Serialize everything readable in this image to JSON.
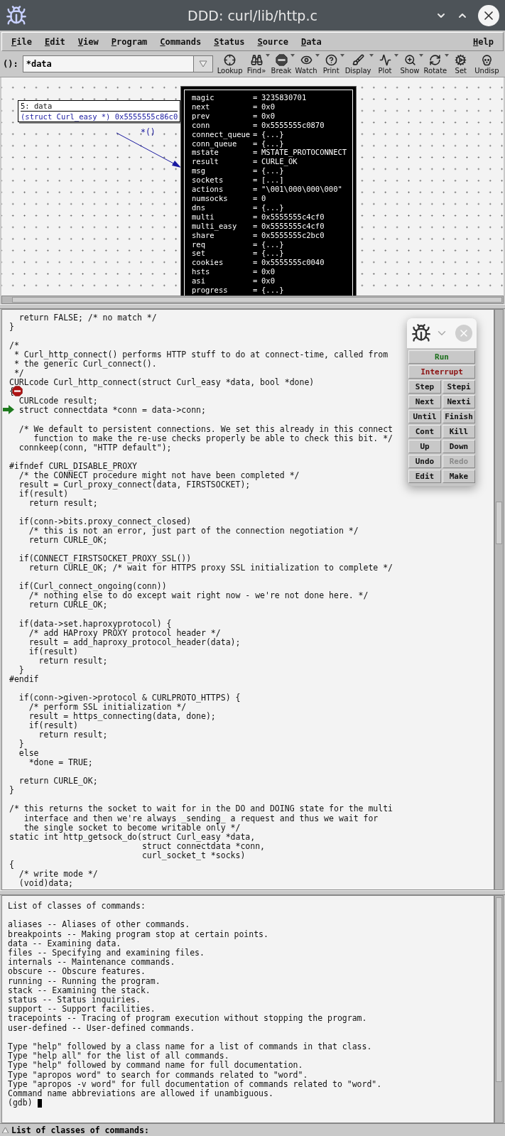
{
  "window": {
    "title": "DDD: curl/lib/http.c"
  },
  "menu": [
    "File",
    "Edit",
    "View",
    "Program",
    "Commands",
    "Status",
    "Source",
    "Data"
  ],
  "help_menu": "Help",
  "argument_field": {
    "label": "():",
    "value": "*data"
  },
  "toolbar": [
    {
      "label": "Lookup",
      "has_menu": false
    },
    {
      "label": "Find»",
      "has_menu": true
    },
    {
      "label": "Break",
      "has_menu": true
    },
    {
      "label": "Watch",
      "has_menu": true
    },
    {
      "label": "Print",
      "has_menu": true
    },
    {
      "label": "Display",
      "has_menu": true
    },
    {
      "label": "Plot",
      "has_menu": true
    },
    {
      "label": "Show",
      "has_menu": true
    },
    {
      "label": "Rotate",
      "has_menu": true
    },
    {
      "label": "Set",
      "has_menu": false
    },
    {
      "label": "Undisp",
      "has_menu": false
    }
  ],
  "data_display": {
    "node": {
      "title": "5: data",
      "value": "(struct Curl_easy *) 0x5555555c86c0"
    },
    "edge_label": "*()",
    "separator": "=",
    "fields": [
      {
        "name": "magic",
        "value": "3235830701"
      },
      {
        "name": "next",
        "value": "0x0"
      },
      {
        "name": "prev",
        "value": "0x0"
      },
      {
        "name": "conn",
        "value": "0x5555555c0870"
      },
      {
        "name": "connect_queue",
        "value": "{...}"
      },
      {
        "name": "conn_queue",
        "value": "{...}"
      },
      {
        "name": "mstate",
        "value": "MSTATE_PROTOCONNECT"
      },
      {
        "name": "result",
        "value": "CURLE_OK"
      },
      {
        "name": "msg",
        "value": "{...}"
      },
      {
        "name": "sockets",
        "value": "[...]"
      },
      {
        "name": "actions",
        "value": "\"\\001\\000\\000\\000\""
      },
      {
        "name": "numsocks",
        "value": "0"
      },
      {
        "name": "dns",
        "value": "{...}"
      },
      {
        "name": "multi",
        "value": "0x5555555c4cf0"
      },
      {
        "name": "multi_easy",
        "value": "0x5555555c4cf0"
      },
      {
        "name": "share",
        "value": "0x5555555c2bc0"
      },
      {
        "name": "req",
        "value": "{...}"
      },
      {
        "name": "set",
        "value": "{...}"
      },
      {
        "name": "cookies",
        "value": "0x5555555c0040"
      },
      {
        "name": "hsts",
        "value": "0x0"
      },
      {
        "name": "asi",
        "value": "0x0"
      },
      {
        "name": "progress",
        "value": "{...}"
      }
    ]
  },
  "source": {
    "lines": [
      {
        "text": "  return FALSE; /* no match */",
        "breakpoint": false,
        "current": false
      },
      {
        "text": "}",
        "breakpoint": false,
        "current": false
      },
      {
        "breakpoint": false,
        "current": false
      },
      {
        "text": "/*",
        "breakpoint": false,
        "current": false
      },
      {
        "text": " * Curl_http_connect() performs HTTP stuff to do at connect-time, called from",
        "breakpoint": false,
        "current": false
      },
      {
        "text": " * the generic Curl_connect().",
        "breakpoint": false,
        "current": false
      },
      {
        "text": " */",
        "breakpoint": false,
        "current": false
      },
      {
        "text": "CURLcode Curl_http_connect(struct Curl_easy *data, bool *done)",
        "breakpoint": false,
        "current": false
      },
      {
        "text": "{",
        "breakpoint": true,
        "current": false
      },
      {
        "text": "  CURLcode result;",
        "breakpoint": false,
        "current": false
      },
      {
        "text": "  struct connectdata *conn = data->conn;",
        "breakpoint": false,
        "current": true
      },
      {
        "breakpoint": false,
        "current": false
      },
      {
        "text": "  /* We default to persistent connections. We set this already in this connect",
        "breakpoint": false,
        "current": false
      },
      {
        "text": "     function to make the re-use checks properly be able to check this bit. */",
        "breakpoint": false,
        "current": false
      },
      {
        "text": "  connkeep(conn, \"HTTP default\");",
        "breakpoint": false,
        "current": false
      },
      {
        "breakpoint": false,
        "current": false
      },
      {
        "text": "#ifndef CURL_DISABLE_PROXY",
        "breakpoint": false,
        "current": false
      },
      {
        "text": "  /* the CONNECT procedure might not have been completed */",
        "breakpoint": false,
        "current": false
      },
      {
        "text": "  result = Curl_proxy_connect(data, FIRSTSOCKET);",
        "breakpoint": false,
        "current": false
      },
      {
        "text": "  if(result)",
        "breakpoint": false,
        "current": false
      },
      {
        "text": "    return result;",
        "breakpoint": false,
        "current": false
      },
      {
        "breakpoint": false,
        "current": false
      },
      {
        "text": "  if(conn->bits.proxy_connect_closed)",
        "breakpoint": false,
        "current": false
      },
      {
        "text": "    /* this is not an error, just part of the connection negotiation */",
        "breakpoint": false,
        "current": false
      },
      {
        "text": "    return CURLE_OK;",
        "breakpoint": false,
        "current": false
      },
      {
        "breakpoint": false,
        "current": false
      },
      {
        "text": "  if(CONNECT_FIRSTSOCKET_PROXY_SSL())",
        "breakpoint": false,
        "current": false
      },
      {
        "text": "    return CURLE_OK; /* wait for HTTPS proxy SSL initialization to complete */",
        "breakpoint": false,
        "current": false
      },
      {
        "breakpoint": false,
        "current": false
      },
      {
        "text": "  if(Curl_connect_ongoing(conn))",
        "breakpoint": false,
        "current": false
      },
      {
        "text": "    /* nothing else to do except wait right now - we're not done here. */",
        "breakpoint": false,
        "current": false
      },
      {
        "text": "    return CURLE_OK;",
        "breakpoint": false,
        "current": false
      },
      {
        "breakpoint": false,
        "current": false
      },
      {
        "text": "  if(data->set.haproxyprotocol) {",
        "breakpoint": false,
        "current": false
      },
      {
        "text": "    /* add HAProxy PROXY protocol header */",
        "breakpoint": false,
        "current": false
      },
      {
        "text": "    result = add_haproxy_protocol_header(data);",
        "breakpoint": false,
        "current": false
      },
      {
        "text": "    if(result)",
        "breakpoint": false,
        "current": false
      },
      {
        "text": "      return result;",
        "breakpoint": false,
        "current": false
      },
      {
        "text": "  }",
        "breakpoint": false,
        "current": false
      },
      {
        "text": "#endif",
        "breakpoint": false,
        "current": false
      },
      {
        "breakpoint": false,
        "current": false
      },
      {
        "text": "  if(conn->given->protocol & CURLPROTO_HTTPS) {",
        "breakpoint": false,
        "current": false
      },
      {
        "text": "    /* perform SSL initialization */",
        "breakpoint": false,
        "current": false
      },
      {
        "text": "    result = https_connecting(data, done);",
        "breakpoint": false,
        "current": false
      },
      {
        "text": "    if(result)",
        "breakpoint": false,
        "current": false
      },
      {
        "text": "      return result;",
        "breakpoint": false,
        "current": false
      },
      {
        "text": "  }",
        "breakpoint": false,
        "current": false
      },
      {
        "text": "  else",
        "breakpoint": false,
        "current": false
      },
      {
        "text": "    *done = TRUE;",
        "breakpoint": false,
        "current": false
      },
      {
        "breakpoint": false,
        "current": false
      },
      {
        "text": "  return CURLE_OK;",
        "breakpoint": false,
        "current": false
      },
      {
        "text": "}",
        "breakpoint": false,
        "current": false
      },
      {
        "breakpoint": false,
        "current": false
      },
      {
        "text": "/* this returns the socket to wait for in the DO and DOING state for the multi",
        "breakpoint": false,
        "current": false
      },
      {
        "text": "   interface and then we're always _sending_ a request and thus we wait for",
        "breakpoint": false,
        "current": false
      },
      {
        "text": "   the single socket to become writable only */",
        "breakpoint": false,
        "current": false
      },
      {
        "text": "static int http_getsock_do(struct Curl_easy *data,",
        "breakpoint": false,
        "current": false
      },
      {
        "text": "                           struct connectdata *conn,",
        "breakpoint": false,
        "current": false
      },
      {
        "text": "                           curl_socket_t *socks)",
        "breakpoint": false,
        "current": false
      },
      {
        "text": "{",
        "breakpoint": false,
        "current": false
      },
      {
        "text": "  /* write mode */",
        "breakpoint": false,
        "current": false
      },
      {
        "text": "  (void)data;",
        "breakpoint": false,
        "current": false
      }
    ]
  },
  "tool_palette": {
    "buttons": [
      {
        "label": "Run",
        "kind": "run",
        "disabled": false
      },
      {
        "label": "Interrupt",
        "kind": "interrupt",
        "disabled": false
      },
      {
        "label": "Step",
        "kind": "normal",
        "disabled": false
      },
      {
        "label": "Stepi",
        "kind": "normal",
        "disabled": false
      },
      {
        "label": "Next",
        "kind": "normal",
        "disabled": false
      },
      {
        "label": "Nexti",
        "kind": "normal",
        "disabled": false
      },
      {
        "label": "Until",
        "kind": "normal",
        "disabled": false
      },
      {
        "label": "Finish",
        "kind": "normal",
        "disabled": false
      },
      {
        "label": "Cont",
        "kind": "normal",
        "disabled": false
      },
      {
        "label": "Kill",
        "kind": "normal",
        "disabled": false
      },
      {
        "label": "Up",
        "kind": "normal",
        "disabled": false
      },
      {
        "label": "Down",
        "kind": "normal",
        "disabled": false
      },
      {
        "label": "Undo",
        "kind": "normal",
        "disabled": false
      },
      {
        "label": "Redo",
        "kind": "normal",
        "disabled": true
      },
      {
        "label": "Edit",
        "kind": "normal",
        "disabled": false
      },
      {
        "label": "Make",
        "kind": "normal",
        "disabled": false
      }
    ]
  },
  "console": {
    "heading": "List of classes of commands:",
    "classes": [
      "aliases -- Aliases of other commands.",
      "breakpoints -- Making program stop at certain points.",
      "data -- Examining data.",
      "files -- Specifying and examining files.",
      "internals -- Maintenance commands.",
      "obscure -- Obscure features.",
      "running -- Running the program.",
      "stack -- Examining the stack.",
      "status -- Status inquiries.",
      "support -- Support facilities.",
      "tracepoints -- Tracing of program execution without stopping the program.",
      "user-defined -- User-defined commands."
    ],
    "hints": [
      "Type \"help\" followed by a class name for a list of commands in that class.",
      "Type \"help all\" for the list of all commands.",
      "Type \"help\" followed by command name for full documentation.",
      "Type \"apropos word\" to search for commands related to \"word\".",
      "Type \"apropos -v word\" for full documentation of commands related to \"word\".",
      "Command name abbreviations are allowed if unambiguous."
    ],
    "prompt": "(gdb)"
  },
  "status_bar": {
    "text": "List of classes of commands:"
  }
}
